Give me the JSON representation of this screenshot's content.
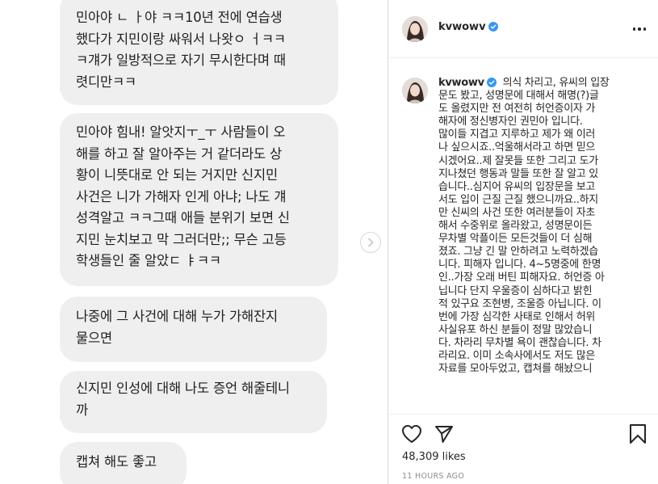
{
  "chat": {
    "bubbles": [
      {
        "lines": [
          "민아야 ㄴ ㅏ야 ㅋㅋ10년 전에 연습생",
          "했다가 지민이랑 싸워서 나왓ㅇ ㅓㅋㅋ",
          "ㅋ걔가 일방적으로 자기 무시한다며 때",
          "렷디만ㅋㅋ"
        ]
      },
      {
        "lines": [
          "민아야 힘내! 알앗지ㅜ_ㅜ 사람들이 오",
          "해를 하고 잘 알아주는 거 같더라도 상",
          "황이 니뜻대로 안 되는 거지만 신지민",
          "사건은 니가 가해자 인게 아냐; 나도 걔",
          "성격알고 ㅋㅋ그때 애들 분위기 보면 신",
          "지민 눈치보고 막 그러더만;; 무슨 고등",
          "학생들인 줄 알았ㄷ ㅑㅋㅋ"
        ]
      },
      {
        "lines": [
          "나중에 그 사건에 대해 누가 가해잔지",
          "물으면"
        ]
      },
      {
        "lines": [
          "신지민 인성에 대해 나도 증언 해줄테니",
          "까"
        ]
      },
      {
        "lines": [
          "캡쳐 해도 좋고"
        ]
      }
    ]
  },
  "icons": {
    "next": "chevron-right-icon",
    "verified": "verified-badge-icon",
    "more": "more-options-icon",
    "like": "heart-icon",
    "share": "paper-plane-icon",
    "save": "bookmark-icon"
  },
  "post": {
    "username": "kvwowv",
    "caption_lines": [
      "의식 차리고, 유씨의 입장",
      "문도 봤고, 성명문에 대해서 해명(?)글",
      "도 올렸지만 전 여전히 허언증이자 가",
      "해자에 정신병자인 권민아 입니다.",
      "많이들 지겹고 지루하고 제가 왜 이러",
      "나 싶으시죠..억울해서라고 하면 믿으",
      "시겠어요..제 잘못들 또한 그리고 도가",
      "지나쳤던 행동과 말들 또한 잘 알고 있",
      "습니다..심지어 유씨의 입장문을 보고",
      "서도 입이 근질 근질 했으니까요..하지",
      "만 신씨의 사건 또한 여러분들이 자초",
      "해서 수중위로 올라왔고, 성명문이든",
      "무차별 악플이든 모든것들이 더 심해",
      "졌죠. 그냥 긴 말 안하려고 노력하겠습",
      "니다. 피해자 입니다. 4~5명중에 한명",
      "인..가장 오래 버틴 피해자요. 허언증 아",
      "닙니다 단지 우울증이 심하다고 밝힌",
      "적 있구요 조현병, 조울증 아닙니다. 이",
      "번에 가장 심각한 사태로 인해서 허위",
      "사실유포 하신 분들이 정말 많았습니",
      "다. 차라리 무차별 욕이 괜찮습니다. 차",
      "라리요. 이미 소속사에서도 저도 많은",
      "자료를 모아두었고, 캡쳐를 해놨으니"
    ],
    "likes": "48,309 likes",
    "time": "11 HOURS AGO"
  },
  "colors": {
    "bubble": "#efefef",
    "verified": "#3897f0",
    "muted": "#8e8e8e",
    "text": "#262626"
  }
}
